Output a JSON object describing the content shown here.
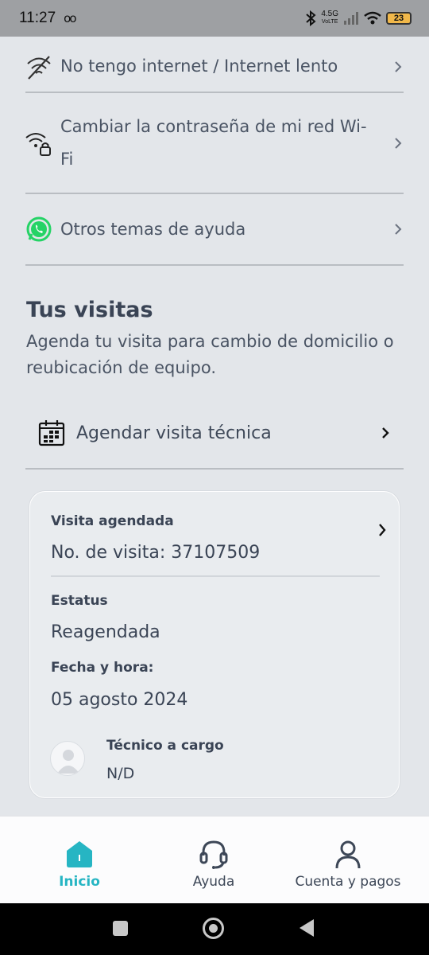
{
  "status_bar": {
    "time": "11:27",
    "network_top": "4.5G",
    "network_bottom": "VoLTE",
    "battery": "23"
  },
  "help_options": [
    {
      "label": "No tengo internet / Internet lento",
      "icon": "wifi-off-icon"
    },
    {
      "label": "Cambiar la contraseña de mi red Wi-Fi",
      "icon": "wifi-lock-icon"
    },
    {
      "label": "Otros temas de ayuda",
      "icon": "whatsapp-icon"
    }
  ],
  "visits": {
    "title": "Tus visitas",
    "description": "Agenda tu visita para cambio de domicilio o reubicación de equipo.",
    "schedule_label": "Agendar visita técnica",
    "card": {
      "title": "Visita agendada",
      "visit_number": "No. de visita: 37107509",
      "status_label": "Estatus",
      "status_value": "Reagendada",
      "date_label": "Fecha y hora:",
      "date_value": "05 agosto 2024",
      "technician_label": "Técnico a cargo",
      "technician_value": "N/D"
    }
  },
  "bottom_nav": {
    "home": "Inicio",
    "help": "Ayuda",
    "account": "Cuenta y pagos"
  },
  "colors": {
    "accent": "#26b5c3",
    "whatsapp": "#25d366",
    "background": "#e3e6ea",
    "text": "#3d4757"
  }
}
